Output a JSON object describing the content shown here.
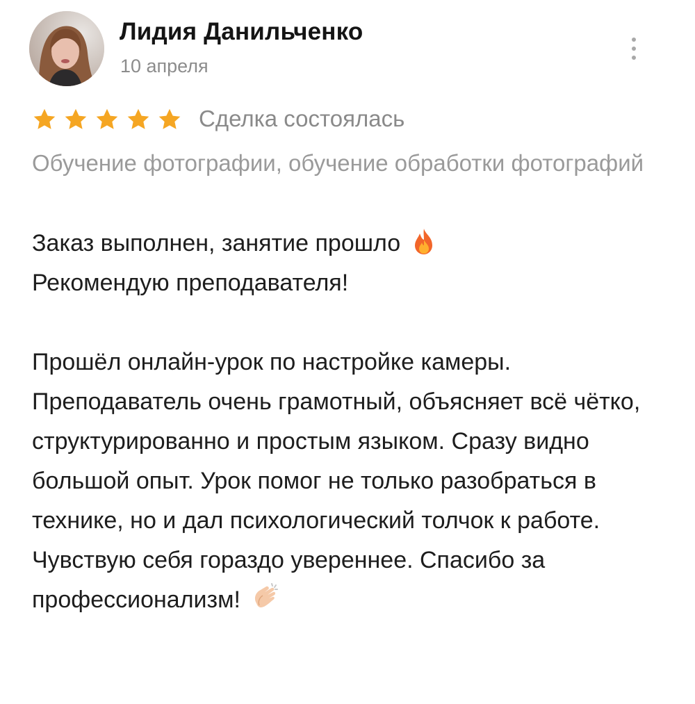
{
  "review": {
    "author_name": "Лидия Данильченко",
    "date": "10 апреля",
    "rating": 5,
    "rating_max": 5,
    "deal_status": "Сделка состоялась",
    "category": "Обучение фотографии, обучение обработки фотографий",
    "paragraph_1_line_1": "Заказ выполнен, занятие прошло",
    "paragraph_1_line_1_emoji": "fire-icon",
    "paragraph_1_line_2": "Рекомендую преподавателя!",
    "paragraph_2": "Прошёл онлайн-урок по настройке камеры. Преподаватель очень грамотный, объясняет всё чётко, структурированно и простым языком. Сразу видно большой опыт. Урок помог не только разобраться в технике, но и дал психологический толчок к работе. Чувствую себя гораздо увереннее. Спасибо за профессионализм!",
    "paragraph_2_emoji": "clapping-hands-icon"
  },
  "colors": {
    "star": "#f5a623",
    "secondary_text": "#8c8c8c",
    "primary_text": "#1d1d1d"
  }
}
